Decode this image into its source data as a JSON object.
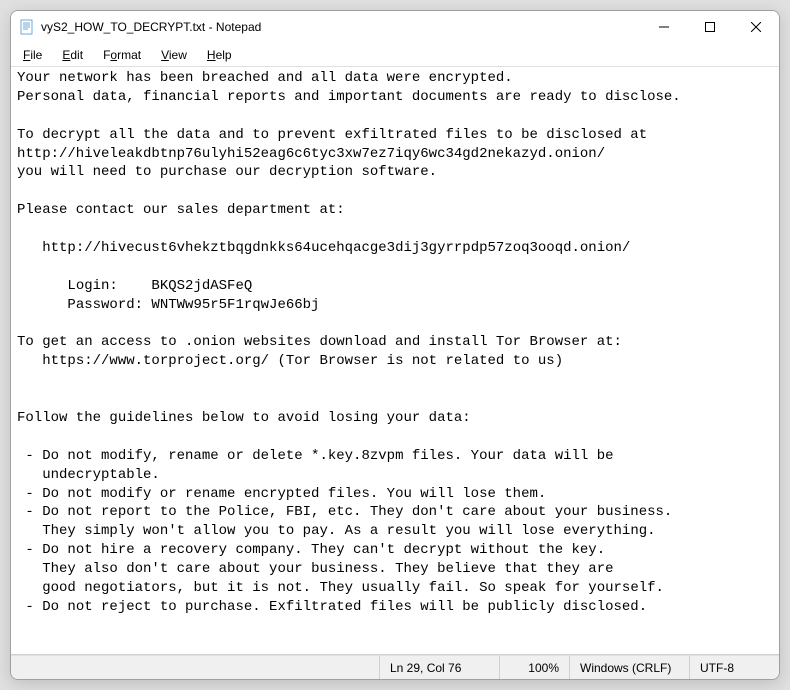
{
  "titlebar": {
    "title": "vyS2_HOW_TO_DECRYPT.txt - Notepad"
  },
  "menubar": {
    "file": "File",
    "edit": "Edit",
    "format": "Format",
    "view": "View",
    "help": "Help"
  },
  "content": {
    "body": "Your network has been breached and all data were encrypted.\nPersonal data, financial reports and important documents are ready to disclose.\n\nTo decrypt all the data and to prevent exfiltrated files to be disclosed at \nhttp://hiveleakdbtnp76ulyhi52eag6c6tyc3xw7ez7iqy6wc34gd2nekazyd.onion/\nyou will need to purchase our decryption software.\n\nPlease contact our sales department at:\n\n   http://hivecust6vhekztbqgdnkks64ucehqacge3dij3gyrrpdp57zoq3ooqd.onion/\n\n      Login:    BKQS2jdASFeQ\n      Password: WNTWw95r5F1rqwJe66bj\n\nTo get an access to .onion websites download and install Tor Browser at:\n   https://www.torproject.org/ (Tor Browser is not related to us)\n\n\nFollow the guidelines below to avoid losing your data:\n\n - Do not modify, rename or delete *.key.8zvpm files. Your data will be \n   undecryptable.\n - Do not modify or rename encrypted files. You will lose them.\n - Do not report to the Police, FBI, etc. They don't care about your business.\n   They simply won't allow you to pay. As a result you will lose everything.\n - Do not hire a recovery company. They can't decrypt without the key.  \n   They also don't care about your business. They believe that they are \n   good negotiators, but it is not. They usually fail. So speak for yourself.\n - Do not reject to purchase. Exfiltrated files will be publicly disclosed."
  },
  "statusbar": {
    "position": "Ln 29, Col 76",
    "zoom": "100%",
    "eol": "Windows (CRLF)",
    "encoding": "UTF-8"
  }
}
